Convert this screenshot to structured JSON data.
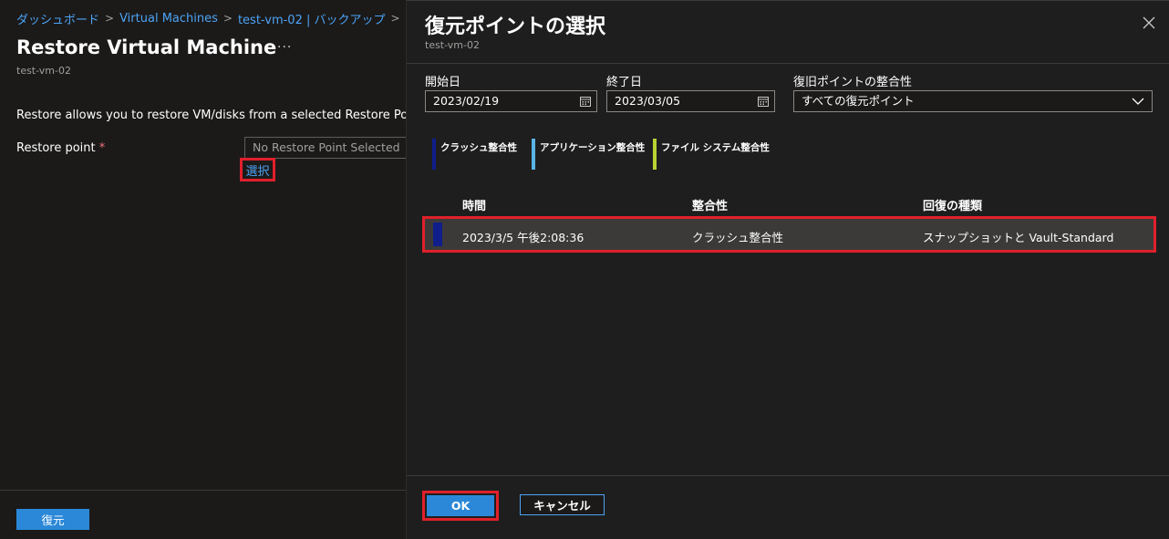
{
  "breadcrumb": {
    "items": [
      "ダッシュボード",
      "Virtual Machines",
      "test-vm-02 | バックアップ"
    ],
    "separator": ">"
  },
  "page": {
    "title": "Restore Virtual Machine",
    "more": "···",
    "subtitle": "test-vm-02",
    "description": "Restore allows you to restore VM/disks from a selected Restore Point.",
    "restore_point_label": "Restore point",
    "required_mark": "*",
    "restore_point_placeholder": "No Restore Point Selected",
    "select_link": "選択",
    "restore_button": "復元"
  },
  "panel": {
    "title": "復元ポイントの選択",
    "subtitle": "test-vm-02",
    "filters": {
      "start_label": "開始日",
      "start_value": "2023/02/19",
      "end_label": "終了日",
      "end_value": "2023/03/05",
      "consistency_label": "復旧ポイントの整合性",
      "consistency_value": "すべての復元ポイント"
    },
    "legend": [
      {
        "label": "クラッシュ整合性",
        "color": "#0f1e8a"
      },
      {
        "label": "アプリケーション整合性",
        "color": "#5ab4e6"
      },
      {
        "label": "ファイル システム整合性",
        "color": "#b8d432"
      }
    ],
    "table": {
      "columns": [
        "時間",
        "整合性",
        "回復の種類"
      ],
      "rows": [
        {
          "time": "2023/3/5 午後2:08:36",
          "consistency": "クラッシュ整合性",
          "recovery_type": "スナップショットと Vault-Standard"
        }
      ]
    },
    "ok_button": "OK",
    "cancel_button": "キャンセル"
  },
  "colors": {
    "accent": "#2b88d8",
    "link": "#4da3f5",
    "highlight": "#e0202b",
    "background": "#1b1a19"
  }
}
